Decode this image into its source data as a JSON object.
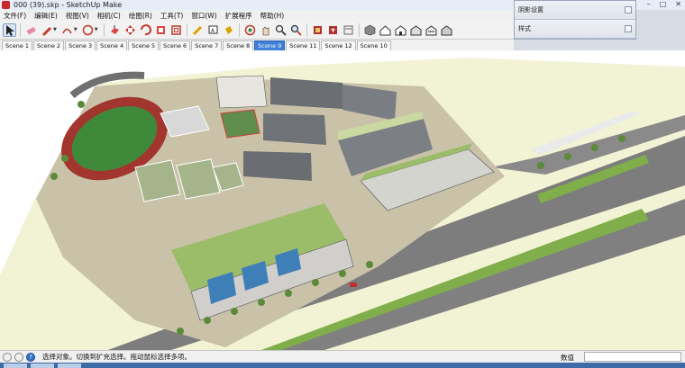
{
  "window": {
    "title": "000 (39).skp - SketchUp Make"
  },
  "menus": [
    "文件(F)",
    "编辑(E)",
    "视图(V)",
    "相机(C)",
    "绘图(R)",
    "工具(T)",
    "窗口(W)",
    "扩展程序",
    "帮助(H)"
  ],
  "toolbar": {
    "tools": [
      {
        "name": "select-icon",
        "active": true
      },
      {
        "name": "eraser-icon"
      },
      {
        "name": "pencil-icon",
        "dropdown": true
      },
      {
        "name": "arc-icon",
        "dropdown": true
      },
      {
        "name": "rectangle-icon",
        "dropdown": true
      },
      {
        "name": "push-pull-icon"
      },
      {
        "name": "move-icon"
      },
      {
        "name": "rotate-icon"
      },
      {
        "name": "scale-icon"
      },
      {
        "name": "offset-icon"
      },
      {
        "name": "tape-measure-icon"
      },
      {
        "name": "text-icon"
      },
      {
        "name": "paint-bucket-icon"
      },
      {
        "name": "orbit-icon"
      },
      {
        "name": "pan-icon"
      },
      {
        "name": "zoom-icon"
      },
      {
        "name": "zoom-extents-icon"
      },
      {
        "name": "warehouse-icon"
      },
      {
        "name": "extension-warehouse-icon"
      },
      {
        "name": "layout-icon"
      },
      {
        "name": "iso-view-icon"
      },
      {
        "name": "top-view-icon"
      },
      {
        "name": "front-view-icon"
      },
      {
        "name": "right-view-icon"
      },
      {
        "name": "back-view-icon"
      },
      {
        "name": "left-view-icon"
      }
    ]
  },
  "scenes": {
    "tabs": [
      "Scene 1",
      "Scene 2",
      "Scene 3",
      "Scene 4",
      "Scene 5",
      "Scene 6",
      "Scene 7",
      "Scene 8",
      "Scene 9",
      "Scene 11",
      "Scene 12",
      "Scene 10"
    ],
    "active_index": 8
  },
  "trays": [
    "阴影设置",
    "样式"
  ],
  "statusbar": {
    "hint": "选择对象。切换到扩充选择。拖动鼠标选择多项。",
    "measurements_label": "数值",
    "measurements_value": ""
  },
  "colors": {
    "accent": "#3d7fd9",
    "track": "#a2362e",
    "field": "#3f8a3a",
    "grass": "#9bbd6a",
    "ground": "#f2f3d4",
    "road": "#7d7d7d"
  }
}
